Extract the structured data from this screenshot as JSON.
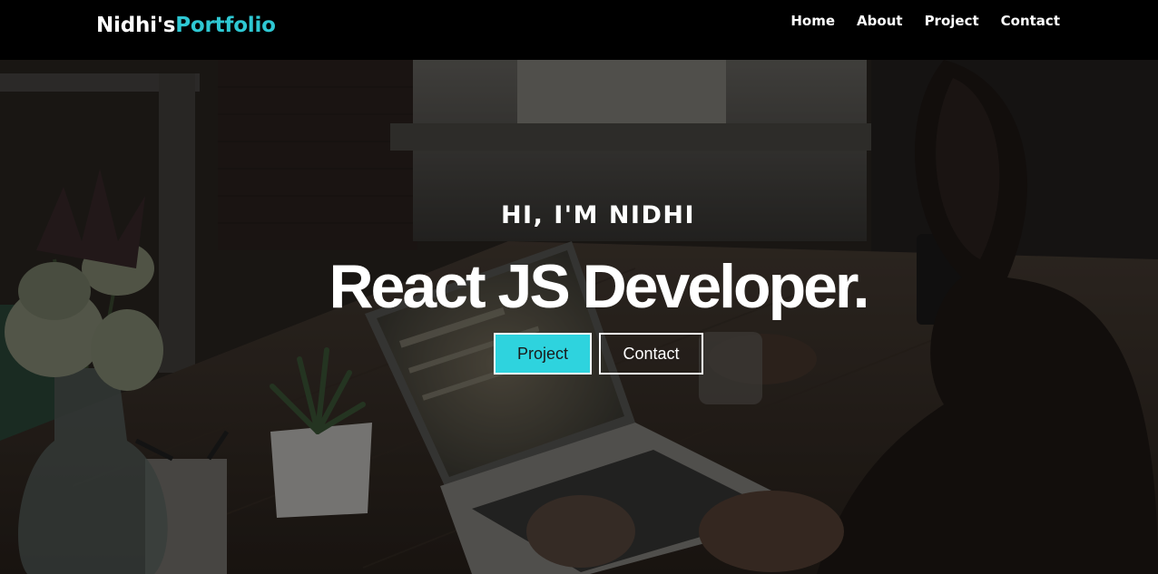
{
  "brand": {
    "name_part1": "Nidhi's",
    "name_part2": "Portfolio",
    "accent_color": "#2ec8d3"
  },
  "nav": {
    "items": [
      {
        "label": "Home"
      },
      {
        "label": "About"
      },
      {
        "label": "Project"
      },
      {
        "label": "Contact"
      }
    ]
  },
  "hero": {
    "greeting": "HI, I'M NIDHI",
    "headline": "React JS Developer.",
    "background_image": "person working on laptop at wooden desk with plants",
    "buttons": {
      "primary_label": "Project",
      "secondary_label": "Contact",
      "primary_color": "#2ed3de"
    }
  }
}
